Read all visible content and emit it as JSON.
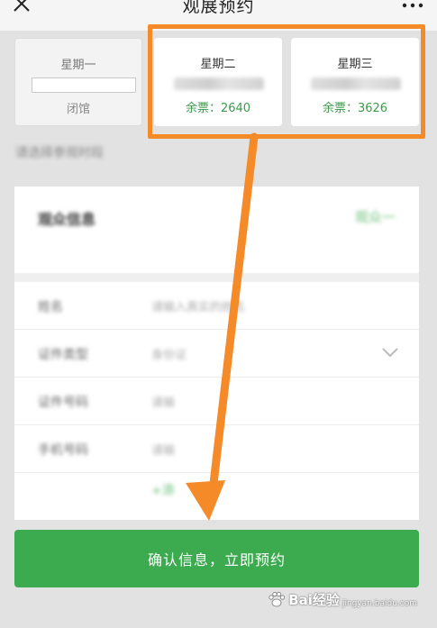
{
  "header": {
    "title": "观展预约"
  },
  "days": [
    {
      "weekday": "星期一",
      "status": "闭馆"
    },
    {
      "weekday": "星期二",
      "remaining": "余票：2640"
    },
    {
      "weekday": "星期三",
      "remaining": "余票：3626"
    }
  ],
  "hint": "请选择参观时段",
  "form": {
    "title": "观众信息",
    "action": "观众一",
    "rows": [
      {
        "label": "姓名",
        "value": "请输入真实的姓名"
      },
      {
        "label": "证件类型",
        "value": "身份证"
      },
      {
        "label": "证件号码",
        "value": "请输"
      },
      {
        "label": "手机号码",
        "value": "请输"
      }
    ],
    "add": "+添"
  },
  "confirm_label": "确认信息，立即预约",
  "watermark": {
    "text": "Bai经验",
    "sub": "jingyan.baidu.com"
  },
  "colors": {
    "accent_green": "#3caa4f",
    "text_green": "#3a9b4a",
    "highlight_orange": "#f58a28"
  },
  "icons": [
    "close-icon",
    "more-icon",
    "chevron-down-icon",
    "paw-icon",
    "arrow-annotation"
  ]
}
